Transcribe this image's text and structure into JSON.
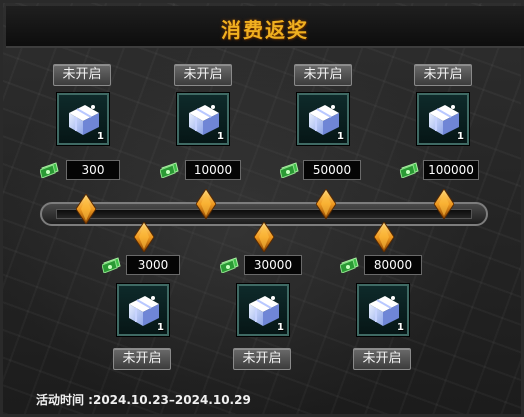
{
  "title": "消费返奖",
  "status_label": "未开启",
  "item_quantity": "1",
  "icons": {
    "reward": "gift-box-icon",
    "currency": "money-bill-icon",
    "milestone": "diamond-marker-icon"
  },
  "colors": {
    "title": "#f0b020",
    "gem": "#e08a10",
    "money": "#3fbf4a"
  },
  "top_rewards": [
    {
      "threshold": "300",
      "status": "未开启",
      "quantity": "1"
    },
    {
      "threshold": "10000",
      "status": "未开启",
      "quantity": "1"
    },
    {
      "threshold": "50000",
      "status": "未开启",
      "quantity": "1"
    },
    {
      "threshold": "100000",
      "status": "未开启",
      "quantity": "1"
    }
  ],
  "bottom_rewards": [
    {
      "threshold": "3000",
      "status": "未开启",
      "quantity": "1"
    },
    {
      "threshold": "30000",
      "status": "未开启",
      "quantity": "1"
    },
    {
      "threshold": "80000",
      "status": "未开启",
      "quantity": "1"
    }
  ],
  "footer": {
    "activity_time": "活动时间 :2024.10.23–2024.10.29"
  }
}
